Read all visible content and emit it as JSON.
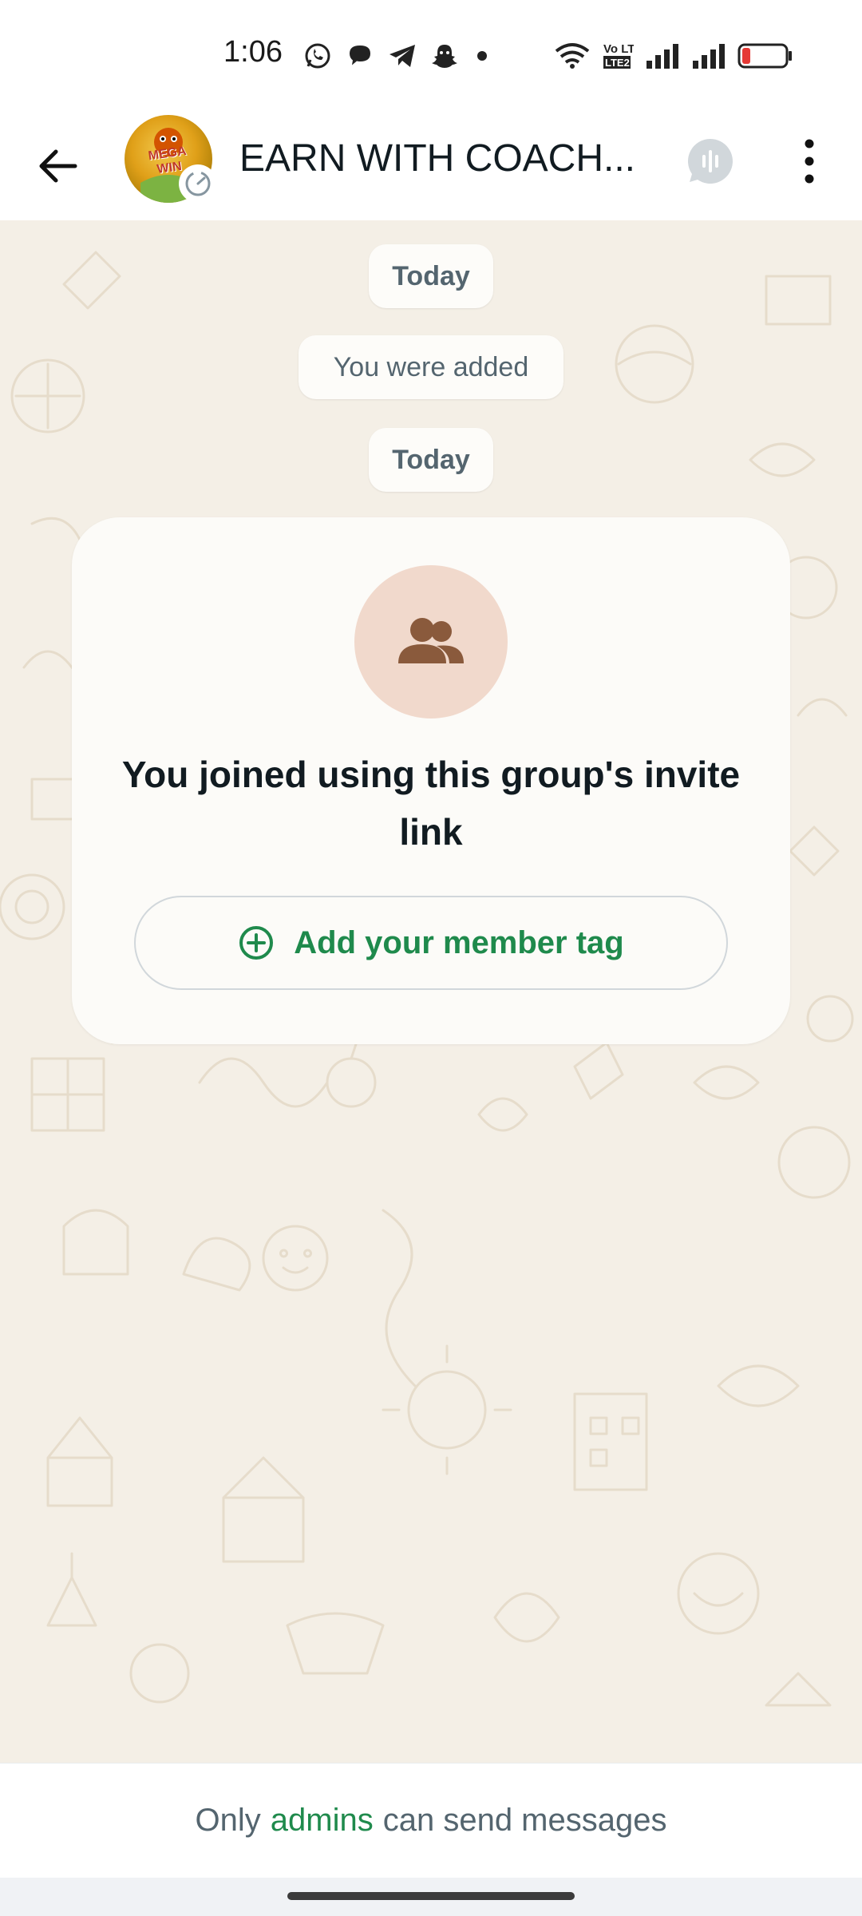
{
  "status_bar": {
    "time": "1:06",
    "left_icons": [
      "whatsapp-icon",
      "chat-bubble-icon",
      "telegram-icon",
      "snapchat-icon",
      "dot-icon"
    ],
    "right_icons": [
      "wifi-icon",
      "volte-icon",
      "signal-icon",
      "signal-icon",
      "battery-icon"
    ],
    "volte_label": "Vo LTE2",
    "battery_color": "#e53935"
  },
  "header": {
    "back_icon": "arrow-left-icon",
    "title": "EARN WITH COACH...",
    "avatar_text": "MEGA WIN",
    "avatar_badge_icon": "disappearing-timer-icon",
    "voice_chat_icon": "voice-chat-icon",
    "menu_icon": "more-vertical-icon"
  },
  "messages": {
    "date_1": "Today",
    "system_added": "You were added",
    "date_2": "Today"
  },
  "invite_card": {
    "icon": "group-icon",
    "text": "You joined using this group's invite link",
    "button_icon": "plus-circle-icon",
    "button_label": "Add your member tag"
  },
  "footer": {
    "prefix": "Only",
    "link": "admins",
    "suffix": "can send messages"
  },
  "colors": {
    "accent_green": "#1f8a4c",
    "chat_background": "#f4efe6",
    "icon_gray": "#54656f",
    "group_icon_bg": "#f1d9cc",
    "group_icon_fg": "#8a5a3c"
  }
}
